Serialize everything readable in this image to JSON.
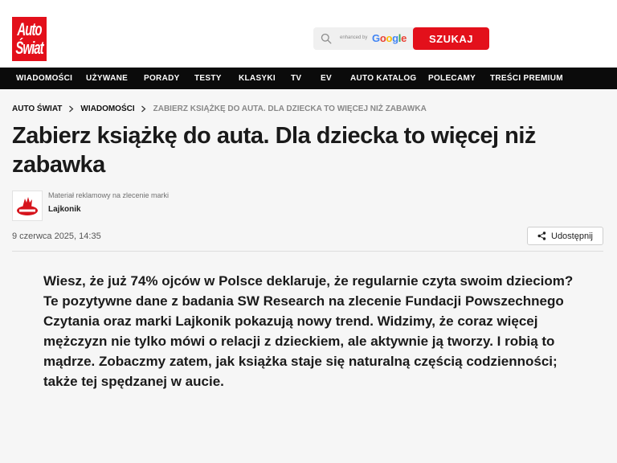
{
  "header": {
    "logo_top": "Auto",
    "logo_bottom": "Świat",
    "search": {
      "enhanced_by": "enhanced by",
      "google": [
        "G",
        "o",
        "o",
        "g",
        "l",
        "e"
      ],
      "button_label": "SZUKAJ"
    }
  },
  "nav": {
    "items": [
      "WIADOMOŚCI",
      "UŻYWANE",
      "PORADY",
      "TESTY",
      "KLASYKI",
      "TV",
      "EV",
      "AUTO KATALOG",
      "POLECAMY",
      "TREŚCI PREMIUM"
    ]
  },
  "breadcrumb": {
    "items": [
      "AUTO ŚWIAT",
      "WIADOMOŚCI",
      "ZABIERZ KSIĄŻKĘ DO AUTA. DLA DZIECKA TO WIĘCEJ NIŻ ZABAWKA"
    ]
  },
  "article": {
    "title": "Zabierz książkę do auta. Dla dziecka to więcej niż zabawka",
    "sponsor_note": "Materiał reklamowy na zlecenie marki",
    "sponsor_name": "Lajkonik",
    "date": "9 czerwca 2025, 14:35",
    "share_label": "Udostępnij",
    "lead": "Wiesz, że już 74% ojców w Polsce deklaruje, że regularnie czyta swoim dzieciom? Te pozytywne dane z badania SW Research na zlecenie Fundacji Powszechnego Czytania oraz marki Lajkonik pokazują nowy trend. Widzimy, że coraz więcej mężczyzn nie tylko mówi o relacji z dzieckiem, ale aktywnie ją tworzy. I robią to mądrze. Zobaczmy zatem, jak książka staje się naturalną częścią codzienności; także tej spędzanej w aucie."
  },
  "colors": {
    "brand_red": "#e3101b",
    "nav_bg": "#0b0b0b",
    "page_bg": "#f6f6f6"
  },
  "icons": {
    "search": "search-icon",
    "chevron": "chevron-right-icon",
    "share": "share-icon",
    "brand": "lajkonik-logo"
  }
}
